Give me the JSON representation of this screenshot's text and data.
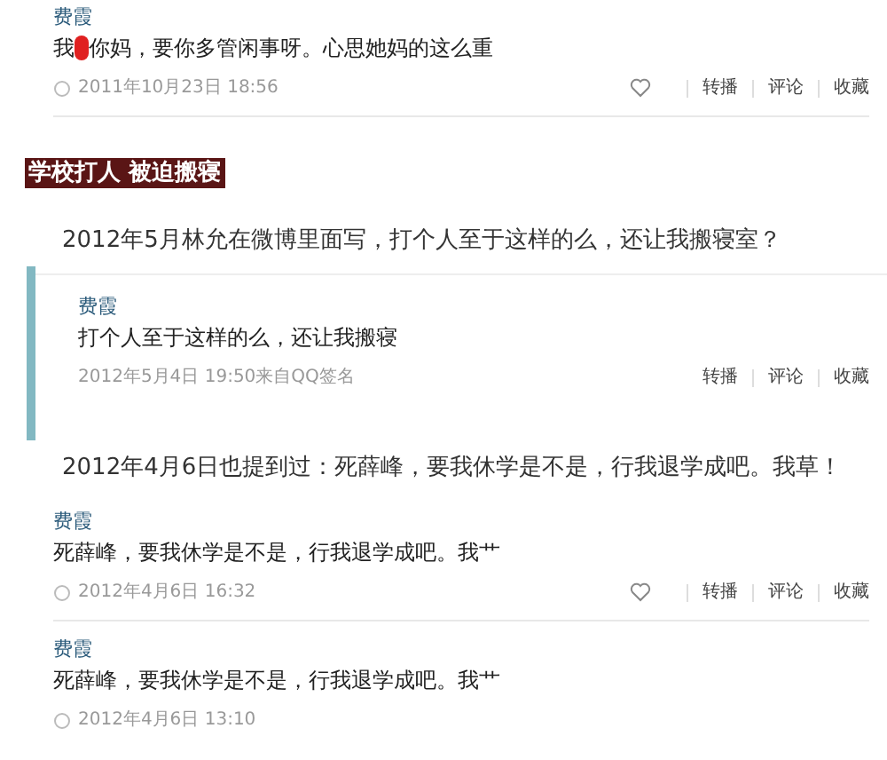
{
  "blocks": [
    {
      "kind": "post",
      "name": "费霞",
      "text_before": "我",
      "censored": true,
      "text": "你妈，要你多管闲事呀。心思她妈的这么重",
      "time": "2011年10月23日 18:56",
      "clock": true,
      "like": true,
      "actions": [
        "转播",
        "评论",
        "收藏"
      ]
    },
    {
      "kind": "banner",
      "text": "学校打人 被迫搬寝"
    },
    {
      "kind": "caption",
      "text": "2012年5月林允在微博里面写，打个人至于这样的么，还让我搬寝室？"
    },
    {
      "kind": "quote",
      "post": {
        "name": "费霞",
        "text": "打个人至于这样的么，还让我搬寝",
        "time": "2012年5月4日 19:50来自QQ签名",
        "actions": [
          "转播",
          "评论",
          "收藏"
        ]
      }
    },
    {
      "kind": "caption",
      "text": "2012年4月6日也提到过：死薛峰，要我休学是不是，行我退学成吧。我草！"
    },
    {
      "kind": "post",
      "name": "费霞",
      "text": "死薛峰，要我休学是不是，行我退学成吧。我艹",
      "time": "2012年4月6日 16:32",
      "clock": true,
      "like": true,
      "actions": [
        "转播",
        "评论",
        "收藏"
      ]
    },
    {
      "kind": "post",
      "name": "费霞",
      "text": "死薛峰，要我休学是不是，行我退学成吧。我艹",
      "time": "2012年4月6日 13:10",
      "clock": true
    }
  ]
}
